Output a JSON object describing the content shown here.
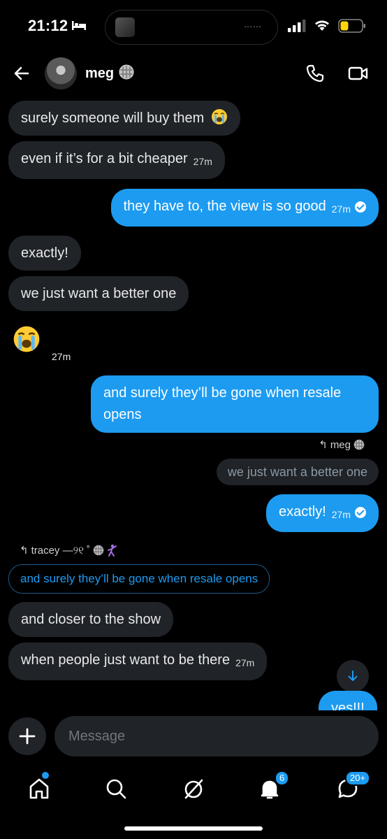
{
  "status_bar": {
    "time": "21:12"
  },
  "header": {
    "contact_name": "meg"
  },
  "messages": {
    "m1": "surely someone will buy them",
    "m2": "even if it’s for a bit cheaper",
    "m2_time": "27m",
    "m3": "they have to, the view is so good",
    "m3_time": "27m",
    "m4": "exactly!",
    "m5": "we just want a better one",
    "m6_time": "27m",
    "m7_line1": "and surely they’ll be gone when resale",
    "m7_line2": "opens",
    "reply1_author": "meg",
    "reply1_quote": "we just want a better one",
    "m8": "exactly!",
    "m8_time": "27m",
    "reply2_author": "tracey —୨୧ ˚",
    "reply2_quote": "and surely they’ll be gone when resale opens",
    "m9": "and closer to the show",
    "m10": "when people just want to be there",
    "m10_time": "27m",
    "m11_partial": "yes!!!"
  },
  "composer": {
    "placeholder": "Message"
  },
  "nav": {
    "notifications_badge": "6",
    "messages_badge": "20+"
  },
  "colors": {
    "accent": "#1d9bf0",
    "bubble_in": "#202327",
    "background": "#000000"
  }
}
